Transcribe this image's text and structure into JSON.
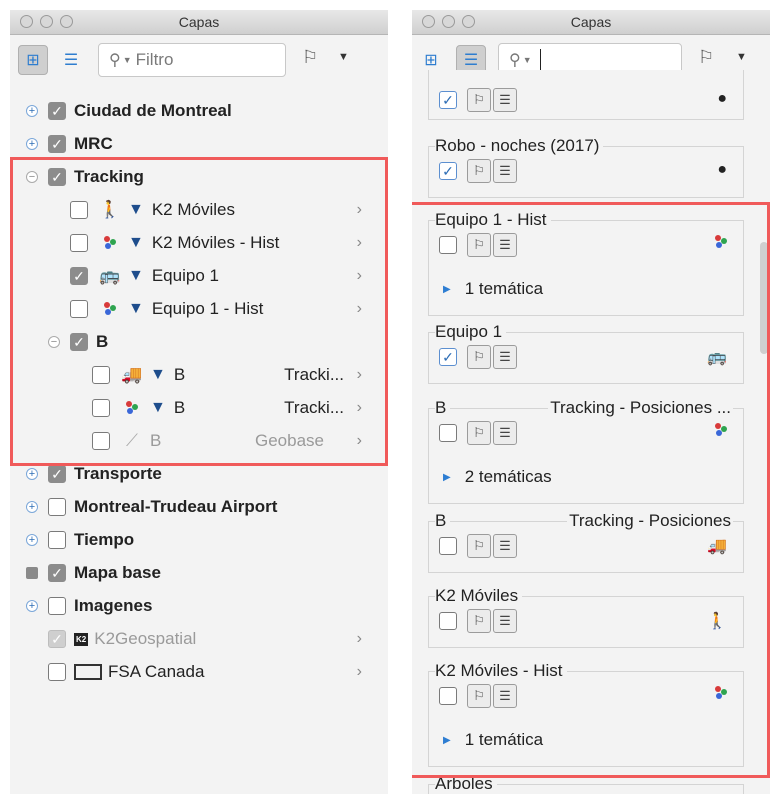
{
  "left": {
    "title": "Capas",
    "search_placeholder": "Filtro",
    "layers": [
      {
        "label": "Ciudad de Montreal"
      },
      {
        "label": "MRC"
      },
      {
        "label": "Tracking"
      },
      {
        "label": "K2 Móviles"
      },
      {
        "label": "K2 Móviles - Hist"
      },
      {
        "label": "Equipo 1"
      },
      {
        "label": "Equipo 1 - Hist"
      },
      {
        "label": "B"
      },
      {
        "label": "B",
        "source": "Tracki..."
      },
      {
        "label": "B",
        "source": "Tracki..."
      },
      {
        "label": "B",
        "source": "Geobase"
      },
      {
        "label": "Transporte"
      },
      {
        "label": "Montreal-Trudeau Airport"
      },
      {
        "label": "Tiempo"
      },
      {
        "label": "Mapa base"
      },
      {
        "label": "Imagenes"
      },
      {
        "label": "K2Geospatial",
        "logo_text": "K2"
      },
      {
        "label": "FSA Canada"
      }
    ]
  },
  "right": {
    "title": "Capas",
    "groups": [
      {
        "label": "Robo - noches (2017)"
      },
      {
        "label": "Equipo 1 - Hist",
        "tematicas": "1 temática"
      },
      {
        "label": "Equipo 1"
      },
      {
        "label": "B",
        "label2": "Tracking - Posiciones ...",
        "tematicas": "2 temáticas"
      },
      {
        "label": "B",
        "label2": "Tracking - Posiciones"
      },
      {
        "label": "K2 Móviles"
      },
      {
        "label": "K2 Móviles - Hist",
        "tematicas": "1 temática"
      },
      {
        "label": "Arboles"
      }
    ]
  },
  "colors": {
    "highlight": "#f05a5a",
    "accent": "#2d6db5"
  }
}
